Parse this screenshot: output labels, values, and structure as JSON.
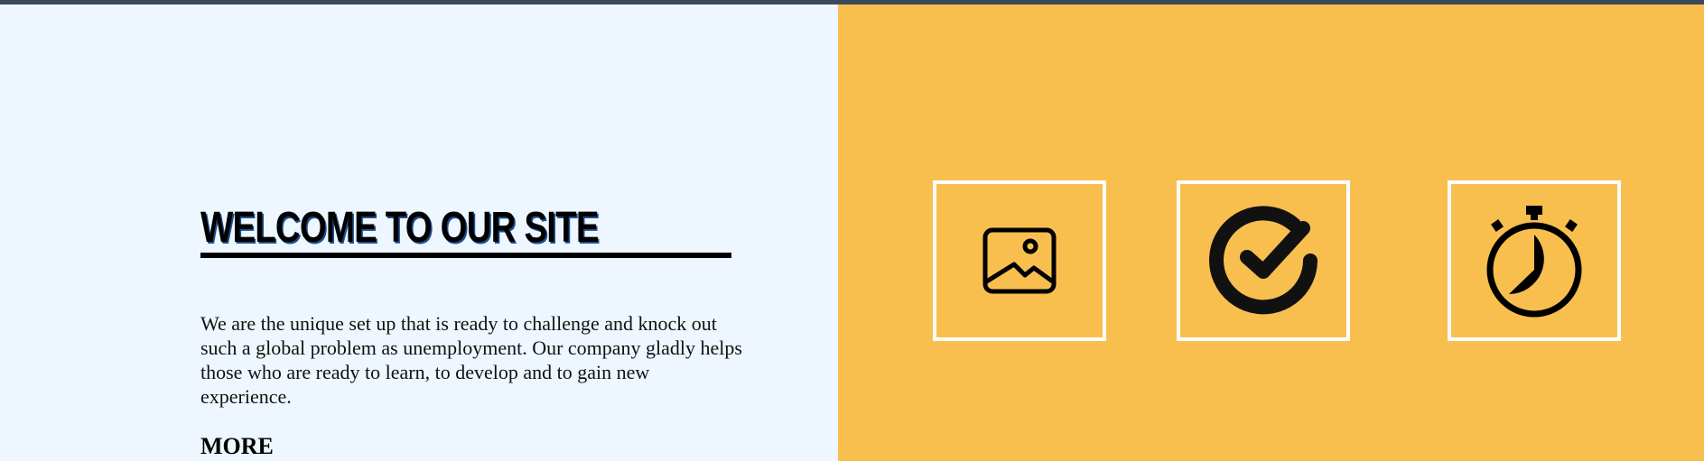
{
  "hero": {
    "title": "WELCOME TO OUR SITE",
    "description": "We are the unique set up that is ready to challenge and knock out such a global problem as unemployment. Our company gladly helps those who are ready to learn, to develop and to gain new experience.",
    "more_label": "MORE"
  },
  "feature_icons": [
    {
      "icon": "image-icon"
    },
    {
      "icon": "check-circle-icon"
    },
    {
      "icon": "stopwatch-icon"
    }
  ],
  "colors": {
    "top_bar": "#3b4a5a",
    "left_background": "#eef7ff",
    "right_background": "#f8bf4f",
    "box_border": "#ffffff",
    "text": "#000000"
  }
}
